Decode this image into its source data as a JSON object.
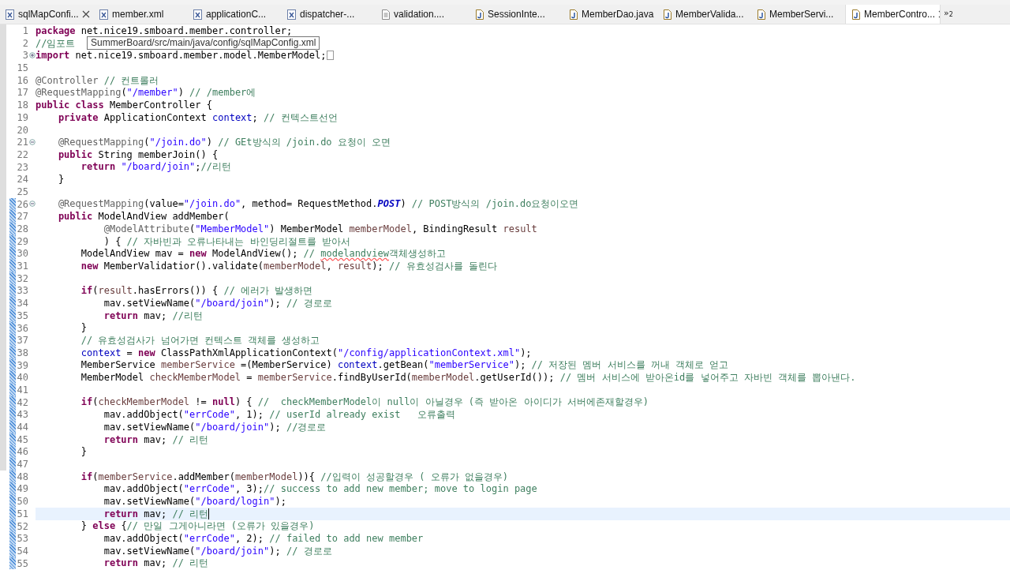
{
  "tabs": [
    {
      "label": "sqlMapConfi...",
      "kind": "xml",
      "selected": false,
      "closable": true
    },
    {
      "label": "member.xml",
      "kind": "xml",
      "selected": false,
      "closable": false
    },
    {
      "label": "applicationC...",
      "kind": "xml",
      "selected": false,
      "closable": false
    },
    {
      "label": "dispatcher-...",
      "kind": "xml",
      "selected": false,
      "closable": false
    },
    {
      "label": "validation....",
      "kind": "text",
      "selected": false,
      "closable": false
    },
    {
      "label": "SessionInte...",
      "kind": "java",
      "selected": false,
      "closable": false
    },
    {
      "label": "MemberDao.java",
      "kind": "java",
      "selected": false,
      "closable": false
    },
    {
      "label": "MemberValida...",
      "kind": "java",
      "selected": false,
      "closable": false
    },
    {
      "label": "MemberServi...",
      "kind": "java",
      "selected": false,
      "closable": false
    },
    {
      "label": "MemberContro...",
      "kind": "java",
      "selected": true,
      "closable": true
    }
  ],
  "overflow": {
    "symbol": "»",
    "count": "2"
  },
  "tooltip": "SummerBoard/src/main/java/config/sqlMapConfig.xml",
  "lines": [
    {
      "number": "1",
      "changed": false,
      "current": false,
      "tokens": [
        {
          "kind": "kw",
          "text": "package"
        },
        {
          "kind": "plain",
          "text": " net.nice19.smboard.member.controller;"
        }
      ]
    },
    {
      "number": "2",
      "changed": false,
      "current": false,
      "tokens": [
        {
          "kind": "comment",
          "text": "//임포트"
        }
      ]
    },
    {
      "number": "3",
      "folded": true,
      "changed": false,
      "current": false,
      "tokens": [
        {
          "kind": "kw",
          "text": "import"
        },
        {
          "kind": "plain",
          "text": " net.nice19.smboard.member.model.MemberModel;"
        }
      ]
    },
    {
      "number": "15",
      "changed": false,
      "current": false
    },
    {
      "number": "16",
      "changed": false,
      "current": false,
      "tokens": [
        {
          "kind": "annot",
          "text": "@Controller"
        },
        {
          "kind": "comment",
          "text": " // 컨트롤러"
        }
      ]
    },
    {
      "number": "17",
      "changed": false,
      "current": false,
      "tokens": [
        {
          "kind": "annot",
          "text": "@RequestMapping"
        },
        {
          "kind": "plain",
          "text": "("
        },
        {
          "kind": "str",
          "text": "\"/member\""
        },
        {
          "kind": "plain",
          "text": ") "
        },
        {
          "kind": "comment",
          "text": "// /member에"
        }
      ]
    },
    {
      "number": "18",
      "changed": false,
      "current": false,
      "tokens": [
        {
          "kind": "kw",
          "text": "public class"
        },
        {
          "kind": "plain",
          "text": " MemberController {"
        }
      ]
    },
    {
      "number": "19",
      "changed": false,
      "current": false,
      "tokens": [
        {
          "kind": "kw",
          "text": "    private"
        },
        {
          "kind": "plain",
          "text": " ApplicationContext "
        },
        {
          "kind": "field",
          "text": "context"
        },
        {
          "kind": "plain",
          "text": "; "
        },
        {
          "kind": "comment",
          "text": "// 컨텍스트선언"
        }
      ]
    },
    {
      "number": "20",
      "changed": false,
      "current": false
    },
    {
      "number": "21",
      "folded": false,
      "changed": false,
      "current": false,
      "tokens": [
        {
          "kind": "annot",
          "text": "    @RequestMapping"
        },
        {
          "kind": "plain",
          "text": "("
        },
        {
          "kind": "str",
          "text": "\"/join.do\""
        },
        {
          "kind": "plain",
          "text": ") "
        },
        {
          "kind": "comment",
          "text": "// GEt방식의 /join.do 요청이 오면"
        }
      ]
    },
    {
      "number": "22",
      "changed": false,
      "current": false,
      "tokens": [
        {
          "kind": "kw",
          "text": "    public"
        },
        {
          "kind": "plain",
          "text": " String memberJoin() {"
        }
      ]
    },
    {
      "number": "23",
      "changed": false,
      "current": false,
      "tokens": [
        {
          "kind": "kw",
          "text": "        return"
        },
        {
          "kind": "str",
          "text": " \"/board/join\""
        },
        {
          "kind": "plain",
          "text": ";"
        },
        {
          "kind": "comment",
          "text": "//리턴"
        }
      ]
    },
    {
      "number": "24",
      "changed": false,
      "current": false,
      "tokens": [
        {
          "kind": "plain",
          "text": "    }"
        }
      ]
    },
    {
      "number": "25",
      "changed": false,
      "current": false
    },
    {
      "number": "26",
      "folded": false,
      "changed": true,
      "current": false,
      "tokens": [
        {
          "kind": "annot",
          "text": "    @RequestMapping"
        },
        {
          "kind": "plain",
          "text": "(value="
        },
        {
          "kind": "str",
          "text": "\"/join.do\""
        },
        {
          "kind": "plain",
          "text": ", method= RequestMethod."
        },
        {
          "kind": "const",
          "text": "POST"
        },
        {
          "kind": "plain",
          "text": ") "
        },
        {
          "kind": "comment",
          "text": "// POST방식의 /join.do요청이오면"
        }
      ]
    },
    {
      "number": "27",
      "changed": true,
      "current": false,
      "tokens": [
        {
          "kind": "kw",
          "text": "    public"
        },
        {
          "kind": "plain",
          "text": " ModelAndView addMember("
        }
      ]
    },
    {
      "number": "28",
      "changed": true,
      "current": false,
      "tokens": [
        {
          "kind": "annot",
          "text": "            @ModelAttribute"
        },
        {
          "kind": "plain",
          "text": "("
        },
        {
          "kind": "str",
          "text": "\"MemberModel\""
        },
        {
          "kind": "plain",
          "text": ") MemberModel "
        },
        {
          "kind": "var",
          "text": "memberModel"
        },
        {
          "kind": "plain",
          "text": ", BindingResult "
        },
        {
          "kind": "var",
          "text": "result"
        }
      ]
    },
    {
      "number": "29",
      "changed": true,
      "current": false,
      "tokens": [
        {
          "kind": "plain",
          "text": "            ) { "
        },
        {
          "kind": "comment",
          "text": "// 자바빈과 오류나타내는 바인딩리절트를 받아서"
        }
      ]
    },
    {
      "number": "30",
      "changed": true,
      "current": false,
      "tokens": [
        {
          "kind": "plain",
          "text": "        ModelAndView mav = "
        },
        {
          "kind": "kw",
          "text": "new"
        },
        {
          "kind": "plain",
          "text": " ModelAndView(); "
        },
        {
          "kind": "comment",
          "text": "// "
        },
        {
          "kind": "misspelled",
          "text": "modelandview"
        },
        {
          "kind": "comment",
          "text": "객체생성하고"
        }
      ]
    },
    {
      "number": "31",
      "changed": true,
      "current": false,
      "tokens": [
        {
          "kind": "kw",
          "text": "        new"
        },
        {
          "kind": "plain",
          "text": " MemberValidatior().validate("
        },
        {
          "kind": "var",
          "text": "memberModel"
        },
        {
          "kind": "plain",
          "text": ", "
        },
        {
          "kind": "var",
          "text": "result"
        },
        {
          "kind": "plain",
          "text": "); "
        },
        {
          "kind": "comment",
          "text": "// 유효성검사를 돌린다"
        }
      ]
    },
    {
      "number": "32",
      "changed": true,
      "current": false
    },
    {
      "number": "33",
      "changed": true,
      "current": false,
      "tokens": [
        {
          "kind": "kw",
          "text": "        if"
        },
        {
          "kind": "plain",
          "text": "("
        },
        {
          "kind": "var",
          "text": "result"
        },
        {
          "kind": "plain",
          "text": ".hasErrors()) { "
        },
        {
          "kind": "comment",
          "text": "// 에러가 발생하면"
        }
      ]
    },
    {
      "number": "34",
      "changed": true,
      "current": false,
      "tokens": [
        {
          "kind": "plain",
          "text": "            mav.setViewName("
        },
        {
          "kind": "str",
          "text": "\"/board/join\""
        },
        {
          "kind": "plain",
          "text": "); "
        },
        {
          "kind": "comment",
          "text": "// 경로로"
        }
      ]
    },
    {
      "number": "35",
      "changed": true,
      "current": false,
      "tokens": [
        {
          "kind": "kw",
          "text": "            return"
        },
        {
          "kind": "plain",
          "text": " mav; "
        },
        {
          "kind": "comment",
          "text": "//리턴"
        }
      ]
    },
    {
      "number": "36",
      "changed": true,
      "current": false,
      "tokens": [
        {
          "kind": "plain",
          "text": "        }"
        }
      ]
    },
    {
      "number": "37",
      "changed": true,
      "current": false,
      "tokens": [
        {
          "kind": "comment",
          "text": "        // 유효성검사가 넘어가면 컨텍스트 객체를 생성하고"
        }
      ]
    },
    {
      "number": "38",
      "changed": true,
      "current": false,
      "tokens": [
        {
          "kind": "field",
          "text": "        context"
        },
        {
          "kind": "plain",
          "text": " = "
        },
        {
          "kind": "kw",
          "text": "new"
        },
        {
          "kind": "plain",
          "text": " ClassPathXmlApplicationContext("
        },
        {
          "kind": "str",
          "text": "\"/config/applicationContext.xml\""
        },
        {
          "kind": "plain",
          "text": ");"
        }
      ]
    },
    {
      "number": "39",
      "changed": true,
      "current": false,
      "tokens": [
        {
          "kind": "plain",
          "text": "        MemberService "
        },
        {
          "kind": "var",
          "text": "memberService"
        },
        {
          "kind": "plain",
          "text": " =(MemberService) "
        },
        {
          "kind": "field",
          "text": "context"
        },
        {
          "kind": "plain",
          "text": ".getBean("
        },
        {
          "kind": "str",
          "text": "\"memberService\""
        },
        {
          "kind": "plain",
          "text": "); "
        },
        {
          "kind": "comment",
          "text": "// 저장된 멤버 서비스를 꺼내 객체로 얻고"
        }
      ]
    },
    {
      "number": "40",
      "changed": true,
      "current": false,
      "tokens": [
        {
          "kind": "plain",
          "text": "        MemberModel "
        },
        {
          "kind": "var",
          "text": "checkMemberModel"
        },
        {
          "kind": "plain",
          "text": " = "
        },
        {
          "kind": "var",
          "text": "memberService"
        },
        {
          "kind": "plain",
          "text": ".findByUserId("
        },
        {
          "kind": "var",
          "text": "memberModel"
        },
        {
          "kind": "plain",
          "text": ".getUserId()); "
        },
        {
          "kind": "comment",
          "text": "// 멤버 서비스에 받아온id를 넣어주고 자바빈 객체를 뽑아낸다."
        }
      ]
    },
    {
      "number": "41",
      "changed": true,
      "current": false
    },
    {
      "number": "42",
      "changed": true,
      "current": false,
      "tokens": [
        {
          "kind": "kw",
          "text": "        if"
        },
        {
          "kind": "plain",
          "text": "("
        },
        {
          "kind": "var",
          "text": "checkMemberModel"
        },
        {
          "kind": "plain",
          "text": " != "
        },
        {
          "kind": "kw",
          "text": "null"
        },
        {
          "kind": "plain",
          "text": ") { "
        },
        {
          "kind": "comment",
          "text": "//  checkMemberModel이 null이 아닐경우 (즉 받아온 아이디가 서버에존재할경우)"
        }
      ]
    },
    {
      "number": "43",
      "changed": true,
      "current": false,
      "tokens": [
        {
          "kind": "plain",
          "text": "            mav.addObject("
        },
        {
          "kind": "str",
          "text": "\"errCode\""
        },
        {
          "kind": "plain",
          "text": ", 1); "
        },
        {
          "kind": "comment",
          "text": "// userId already exist   오류출력"
        }
      ]
    },
    {
      "number": "44",
      "changed": true,
      "current": false,
      "tokens": [
        {
          "kind": "plain",
          "text": "            mav.setViewName("
        },
        {
          "kind": "str",
          "text": "\"/board/join\""
        },
        {
          "kind": "plain",
          "text": "); "
        },
        {
          "kind": "comment",
          "text": "//경로로"
        }
      ]
    },
    {
      "number": "45",
      "changed": true,
      "current": false,
      "tokens": [
        {
          "kind": "kw",
          "text": "            return"
        },
        {
          "kind": "plain",
          "text": " mav; "
        },
        {
          "kind": "comment",
          "text": "// 리턴"
        }
      ]
    },
    {
      "number": "46",
      "changed": true,
      "current": false,
      "tokens": [
        {
          "kind": "plain",
          "text": "        }"
        }
      ]
    },
    {
      "number": "47",
      "changed": true,
      "current": false
    },
    {
      "number": "48",
      "changed": true,
      "current": false,
      "tokens": [
        {
          "kind": "kw",
          "text": "        if"
        },
        {
          "kind": "plain",
          "text": "("
        },
        {
          "kind": "var",
          "text": "memberService"
        },
        {
          "kind": "plain",
          "text": ".addMember("
        },
        {
          "kind": "var",
          "text": "memberModel"
        },
        {
          "kind": "plain",
          "text": ")){ "
        },
        {
          "kind": "comment",
          "text": "//입력이 성공할경우 ( 오류가 없을경우)"
        }
      ]
    },
    {
      "number": "49",
      "changed": true,
      "current": false,
      "tokens": [
        {
          "kind": "plain",
          "text": "            mav.addObject("
        },
        {
          "kind": "str",
          "text": "\"errCode\""
        },
        {
          "kind": "plain",
          "text": ", 3);"
        },
        {
          "kind": "comment",
          "text": "// success to add new member; move to login page"
        }
      ]
    },
    {
      "number": "50",
      "changed": true,
      "current": false,
      "tokens": [
        {
          "kind": "plain",
          "text": "            mav.setViewName("
        },
        {
          "kind": "str",
          "text": "\"/board/login\""
        },
        {
          "kind": "plain",
          "text": ");"
        }
      ]
    },
    {
      "number": "51",
      "changed": true,
      "current": true,
      "tokens": [
        {
          "kind": "kw",
          "text": "            return"
        },
        {
          "kind": "plain",
          "text": " mav; "
        },
        {
          "kind": "comment",
          "text": "// 리턴"
        }
      ]
    },
    {
      "number": "52",
      "changed": true,
      "current": false,
      "tokens": [
        {
          "kind": "plain",
          "text": "        } "
        },
        {
          "kind": "kw",
          "text": "else"
        },
        {
          "kind": "plain",
          "text": " {"
        },
        {
          "kind": "comment",
          "text": "// 만일 그게아니라면 (오류가 있을경우)"
        }
      ]
    },
    {
      "number": "53",
      "changed": true,
      "current": false,
      "tokens": [
        {
          "kind": "plain",
          "text": "            mav.addObject("
        },
        {
          "kind": "str",
          "text": "\"errCode\""
        },
        {
          "kind": "plain",
          "text": ", 2); "
        },
        {
          "kind": "comment",
          "text": "// failed to add new member"
        }
      ]
    },
    {
      "number": "54",
      "changed": true,
      "current": false,
      "tokens": [
        {
          "kind": "plain",
          "text": "            mav.setViewName("
        },
        {
          "kind": "str",
          "text": "\"/board/join\""
        },
        {
          "kind": "plain",
          "text": "); "
        },
        {
          "kind": "comment",
          "text": "// 경로로"
        }
      ]
    },
    {
      "number": "55",
      "changed": true,
      "current": false,
      "tokens": [
        {
          "kind": "kw",
          "text": "            return"
        },
        {
          "kind": "plain",
          "text": " mav; "
        },
        {
          "kind": "comment",
          "text": "// 리턴"
        }
      ]
    }
  ]
}
